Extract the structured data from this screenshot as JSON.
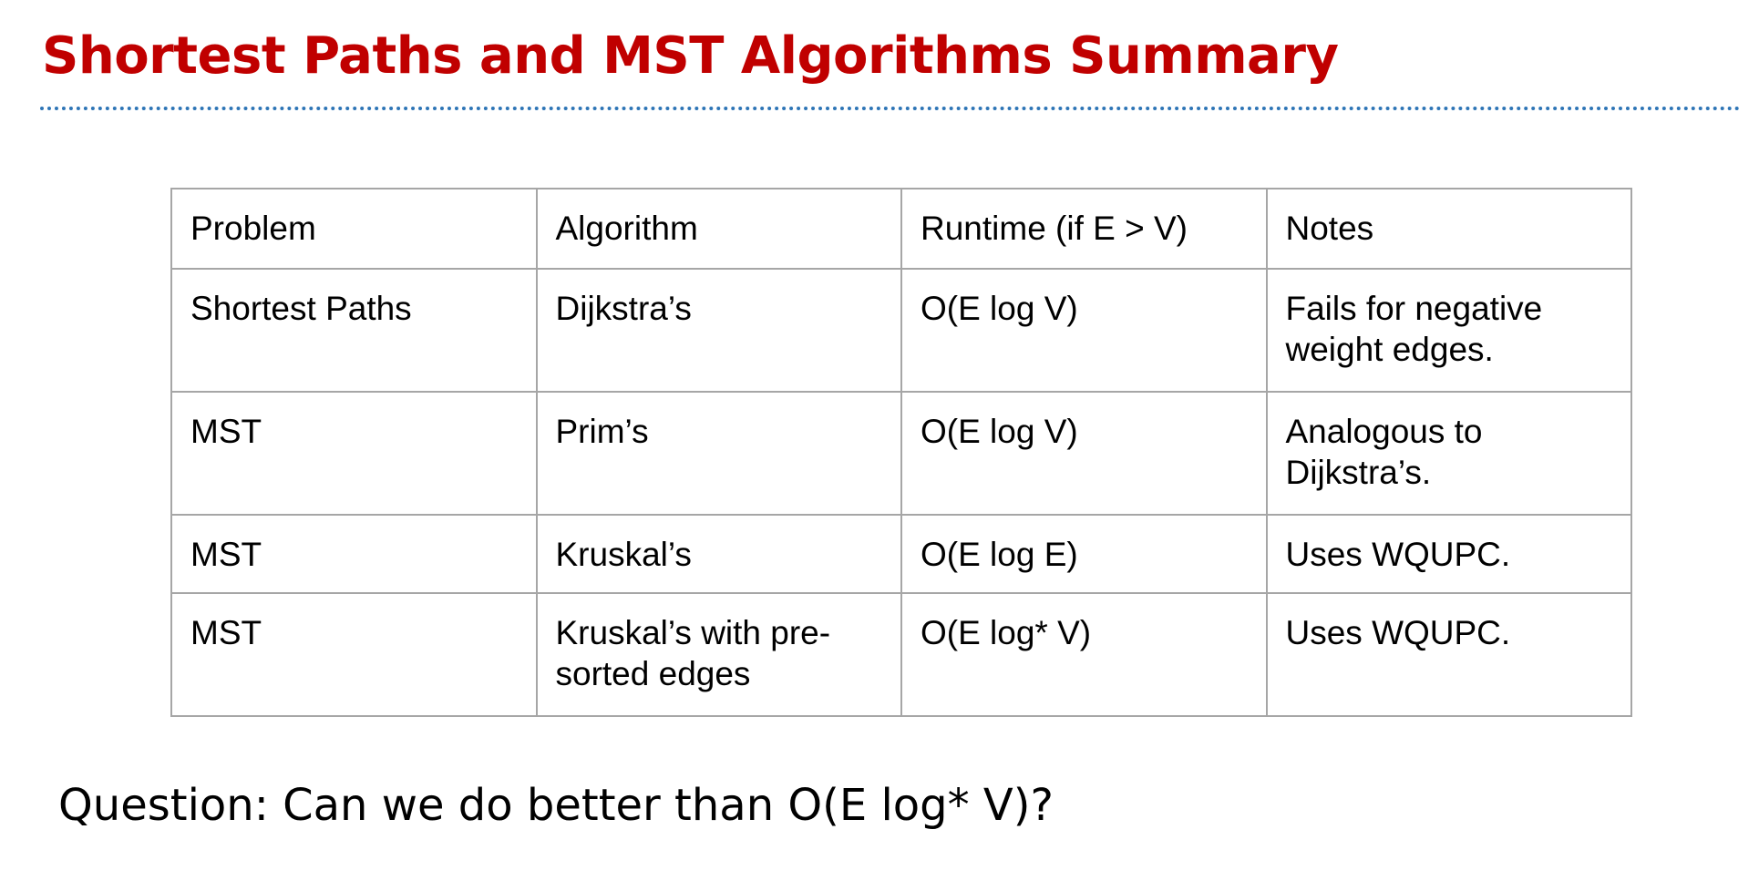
{
  "title": "Shortest Paths and MST Algorithms Summary",
  "table": {
    "headers": [
      "Problem",
      "Algorithm",
      "Runtime (if E > V)",
      "Notes"
    ],
    "rows": [
      [
        "Shortest Paths",
        "Dijkstra’s",
        "O(E log V)",
        "Fails for negative weight edges."
      ],
      [
        "MST",
        "Prim’s",
        "O(E log V)",
        "Analogous to Dijkstra’s."
      ],
      [
        "MST",
        "Kruskal’s",
        "O(E log E)",
        "Uses WQUPC."
      ],
      [
        "MST",
        "Kruskal’s with pre-sorted edges",
        "O(E log* V)",
        "Uses WQUPC."
      ]
    ]
  },
  "question": "Question: Can we do better than O(E log* V)?",
  "colors": {
    "title": "#c00000",
    "rule": "#2e75b6",
    "table_border": "#a6a6a6"
  }
}
